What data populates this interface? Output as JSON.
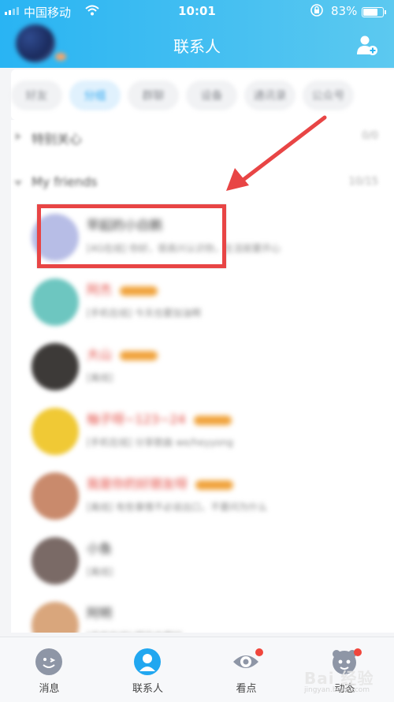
{
  "status_bar": {
    "carrier": "中国移动",
    "time": "10:01",
    "battery_text": "83%",
    "battery_level": 0.83
  },
  "header": {
    "title": "联系人",
    "add_friend_icon": "add-person-icon"
  },
  "tabs": [
    "好友",
    "分组",
    "群聊",
    "设备",
    "通讯录",
    "公众号"
  ],
  "groups": [
    {
      "name": "特别关心",
      "count": "0/0",
      "expanded": false
    },
    {
      "name": "My friends",
      "count": "10/15",
      "expanded": true
    }
  ],
  "contacts": [
    {
      "name": "早起的小白鹅",
      "signature": "[4G在线] 你好，很高兴认识你，生活就要开心",
      "name_color": "#333333",
      "avatar_color": "#b7bde6",
      "vip": false
    },
    {
      "name": "阿杰",
      "signature": "[手机在线] 今天也要加油啊",
      "name_color": "#e2453c",
      "avatar_color": "#6dc6c0",
      "vip": true
    },
    {
      "name": "大山",
      "signature": "[离线]",
      "name_color": "#e2453c",
      "avatar_color": "#3d3a38",
      "vip": true
    },
    {
      "name": "柚子呀~123~24",
      "signature": "[手机在线] 分享歌曲 we/heyyong",
      "name_color": "#e2453c",
      "avatar_color": "#f0c935",
      "vip": true
    },
    {
      "name": "我是你的好朋友呀",
      "signature": "[离线] 有些事情不必说出口，不要问为什么",
      "name_color": "#e2453c",
      "avatar_color": "#c98a6c",
      "vip": true
    },
    {
      "name": "小鱼",
      "signature": "[离线]",
      "name_color": "#333333",
      "avatar_color": "#7a6a66",
      "vip": false
    },
    {
      "name": "阿明",
      "signature": "[手机在线] 明天会更好",
      "name_color": "#333333",
      "avatar_color": "#d9a67c",
      "vip": false
    }
  ],
  "bottom_nav": [
    {
      "label": "消息",
      "icon": "message-face-icon",
      "active": false,
      "dot": false
    },
    {
      "label": "联系人",
      "icon": "contacts-person-icon",
      "active": true,
      "dot": false
    },
    {
      "label": "看点",
      "icon": "eye-icon",
      "active": false,
      "dot": true
    },
    {
      "label": "动态",
      "icon": "star-face-icon",
      "active": false,
      "dot": true
    }
  ],
  "watermark": {
    "text": "Bai 经验",
    "url": "jingyan.baidu.com"
  },
  "colors": {
    "header_gradient_start": "#29b4f3",
    "annotation_red": "#e84545",
    "active_tab": "#29a5ef"
  }
}
